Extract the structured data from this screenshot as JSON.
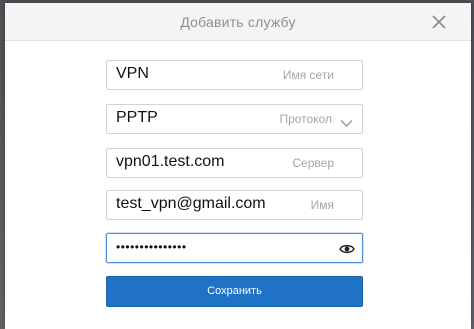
{
  "dialog": {
    "title": "Добавить службу",
    "close_icon": "close-icon"
  },
  "fields": {
    "network_name": {
      "value": "VPN",
      "hint": "Имя сети"
    },
    "protocol": {
      "value": "PPTP",
      "hint": "Протокол",
      "icon": "chevron-down-icon"
    },
    "server": {
      "value": "vpn01.test.com",
      "hint": "Сервер"
    },
    "username": {
      "value": "test_vpn@gmail.com",
      "hint": "Имя"
    },
    "password": {
      "masked_value": "•••••••••••••••",
      "icon": "eye-icon"
    }
  },
  "save_label": "Сохранить",
  "colors": {
    "accent": "#1f72c6",
    "focus_border": "#4a90d9",
    "hint_text": "#a6a6a6"
  }
}
